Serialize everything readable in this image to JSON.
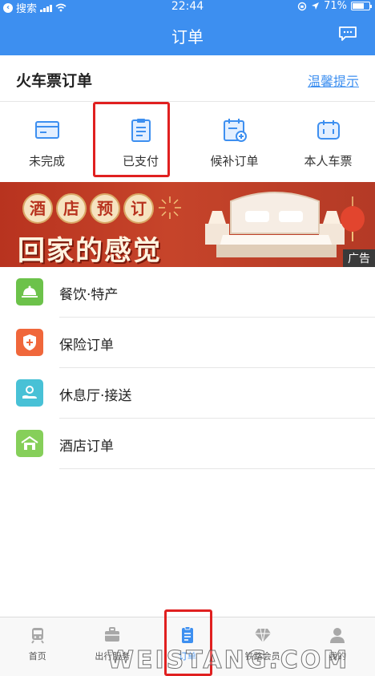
{
  "status_bar": {
    "back_label": "搜索",
    "time": "22:44",
    "battery": "71%",
    "battery_level": 0.71
  },
  "header": {
    "title": "订单"
  },
  "section": {
    "title": "火车票订单",
    "tip": "温馨提示"
  },
  "categories": [
    {
      "label": "未完成",
      "icon": "card-icon"
    },
    {
      "label": "已支付",
      "icon": "clipboard-icon"
    },
    {
      "label": "候补订单",
      "icon": "calendar-plus-icon"
    },
    {
      "label": "本人车票",
      "icon": "ticket-icon"
    }
  ],
  "banner": {
    "chars": [
      "酒",
      "店",
      "预",
      "订"
    ],
    "headline": "回家的感觉",
    "ad_label": "广告"
  },
  "list": [
    {
      "label": "餐饮·特产",
      "icon": "food-bell-icon",
      "color": "#6cc24a"
    },
    {
      "label": "保险订单",
      "icon": "shield-plus-icon",
      "color": "#f0673b"
    },
    {
      "label": "休息厅·接送",
      "icon": "person-hand-icon",
      "color": "#48c1d6"
    },
    {
      "label": "酒店订单",
      "icon": "hotel-icon",
      "color": "#86cf5a"
    }
  ],
  "tabs": [
    {
      "label": "首页",
      "icon": "train-icon",
      "active": false
    },
    {
      "label": "出行服务",
      "icon": "suitcase-icon",
      "active": false
    },
    {
      "label": "订单",
      "icon": "order-icon",
      "active": true
    },
    {
      "label": "铁路会员",
      "icon": "diamond-icon",
      "active": false
    },
    {
      "label": "我的",
      "icon": "user-icon",
      "active": false
    }
  ],
  "watermark": "WEISTANG.COM",
  "colors": {
    "primary": "#3d8ff0",
    "highlight": "#e02020",
    "banner": "#b8331f"
  }
}
